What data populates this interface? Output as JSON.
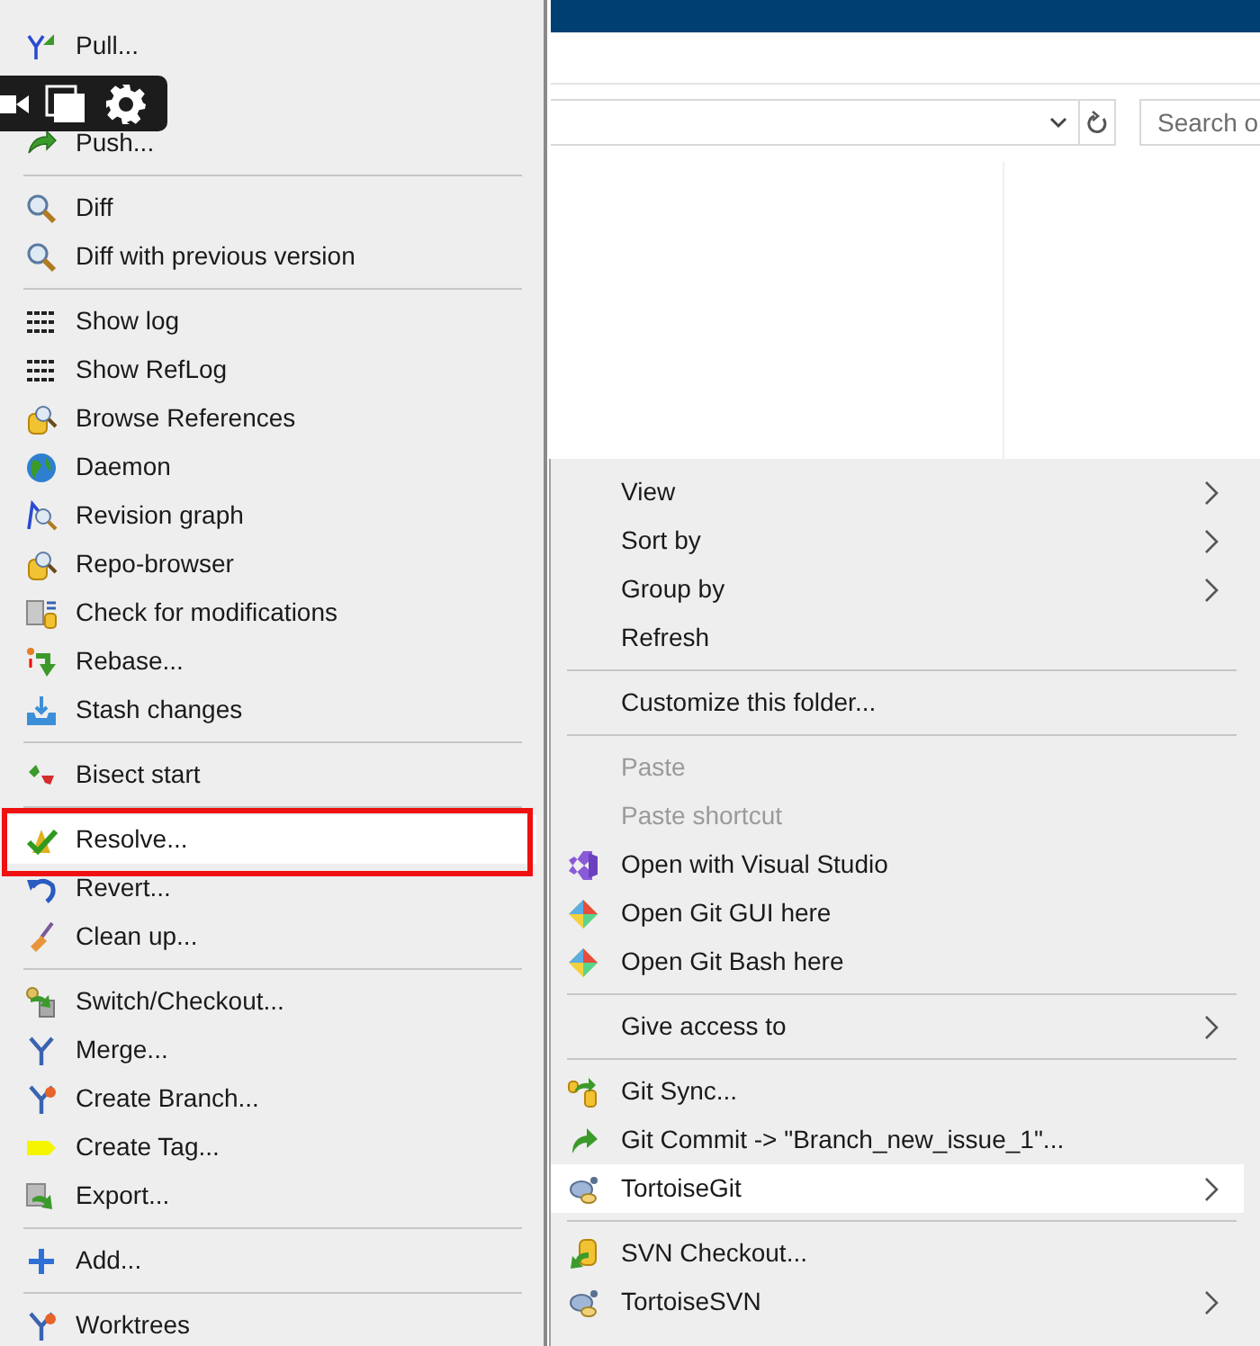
{
  "explorer": {
    "search": {
      "placeholder": "Search o"
    }
  },
  "left_menu": {
    "callout": true,
    "groups": [
      {
        "items": [
          {
            "label": "Pull...",
            "selected": false
          },
          {
            "label": "Push...",
            "selected": false
          }
        ]
      },
      {
        "items": [
          {
            "label": "Diff",
            "selected": false
          },
          {
            "label": "Diff with previous version",
            "selected": false
          }
        ]
      },
      {
        "items": [
          {
            "label": "Show log",
            "selected": false
          },
          {
            "label": "Show RefLog",
            "selected": false
          },
          {
            "label": "Browse References",
            "selected": false
          },
          {
            "label": "Daemon",
            "selected": false
          },
          {
            "label": "Revision graph",
            "selected": false
          },
          {
            "label": "Repo-browser",
            "selected": false
          },
          {
            "label": "Check for modifications",
            "selected": false
          },
          {
            "label": "Rebase...",
            "selected": false
          },
          {
            "label": "Stash changes",
            "selected": false
          }
        ]
      },
      {
        "items": [
          {
            "label": "Bisect start",
            "selected": false
          }
        ]
      },
      {
        "items": [
          {
            "label": "Resolve...",
            "selected": true
          },
          {
            "label": "Revert...",
            "selected": false
          },
          {
            "label": "Clean up...",
            "selected": false
          }
        ]
      },
      {
        "items": [
          {
            "label": "Switch/Checkout...",
            "selected": false
          },
          {
            "label": "Merge...",
            "selected": false
          },
          {
            "label": "Create Branch...",
            "selected": false
          },
          {
            "label": "Create Tag...",
            "selected": false
          },
          {
            "label": "Export...",
            "selected": false
          }
        ]
      },
      {
        "items": [
          {
            "label": "Add...",
            "selected": false
          }
        ]
      },
      {
        "items": [
          {
            "label": "Worktrees",
            "selected": false
          }
        ]
      }
    ]
  },
  "right_menu": {
    "groups": [
      {
        "items": [
          {
            "label": "View",
            "selected": false,
            "submenu": true,
            "disabled": false
          },
          {
            "label": "Sort by",
            "selected": false,
            "submenu": true,
            "disabled": false
          },
          {
            "label": "Group by",
            "selected": false,
            "submenu": true,
            "disabled": false
          },
          {
            "label": "Refresh",
            "selected": false,
            "submenu": false,
            "disabled": false
          }
        ]
      },
      {
        "items": [
          {
            "label": "Customize this folder...",
            "selected": false,
            "submenu": false,
            "disabled": false
          }
        ]
      },
      {
        "items": [
          {
            "label": "Paste",
            "selected": false,
            "submenu": false,
            "disabled": true
          },
          {
            "label": "Paste shortcut",
            "selected": false,
            "submenu": false,
            "disabled": true
          },
          {
            "label": "Open with Visual Studio",
            "selected": false,
            "submenu": false,
            "disabled": false
          },
          {
            "label": "Open Git GUI here",
            "selected": false,
            "submenu": false,
            "disabled": false
          },
          {
            "label": "Open Git Bash here",
            "selected": false,
            "submenu": false,
            "disabled": false
          }
        ]
      },
      {
        "items": [
          {
            "label": "Give access to",
            "selected": false,
            "submenu": true,
            "disabled": false
          }
        ]
      },
      {
        "items": [
          {
            "label": "Git Sync...",
            "selected": false,
            "submenu": false,
            "disabled": false
          },
          {
            "label": "Git Commit -> \"Branch_new_issue_1\"...",
            "selected": false,
            "submenu": false,
            "disabled": false
          },
          {
            "label": "TortoiseGit",
            "selected": true,
            "submenu": true,
            "disabled": false
          }
        ]
      },
      {
        "items": [
          {
            "label": "SVN Checkout...",
            "selected": false,
            "submenu": false,
            "disabled": false
          },
          {
            "label": "TortoiseSVN",
            "selected": false,
            "submenu": true,
            "disabled": false
          }
        ]
      }
    ]
  }
}
